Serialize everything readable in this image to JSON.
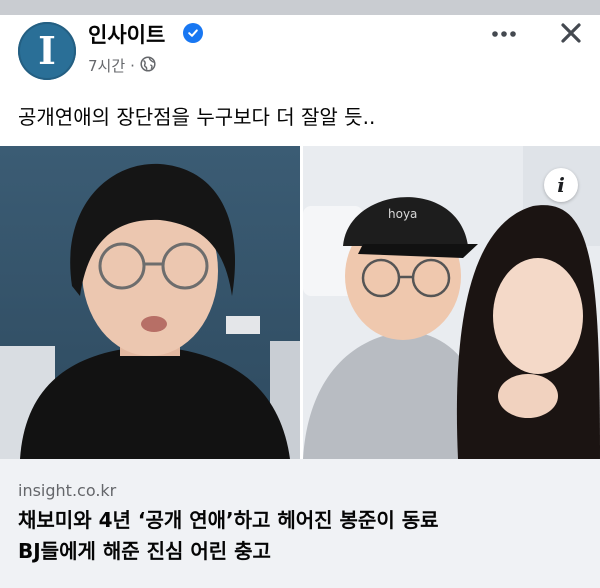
{
  "post": {
    "page_name": "인사이트",
    "avatar_letter": "I",
    "timestamp": "7시간",
    "separator": "·",
    "privacy_icon": "globe-icon",
    "verified_icon": "verified-badge-icon",
    "caption": "공개연애의 장단점을 누구보다 더 잘알 듯..",
    "actions": {
      "more_icon": "more-options-icon",
      "close_icon": "close-icon"
    }
  },
  "media": {
    "info_label": "i",
    "cap_text": "hoya"
  },
  "link_preview": {
    "domain": "insight.co.kr",
    "title_line1": "채보미와 4년 ‘공개 연애’하고 헤어진 봉준이 동료",
    "title_line2": "BJ들에게 해준 진심 어린 충고"
  },
  "colors": {
    "accent": "#1877f2",
    "avatar_bg": "#2a6f97",
    "secondary_text": "#65676b",
    "link_box_bg": "#f0f2f5"
  }
}
